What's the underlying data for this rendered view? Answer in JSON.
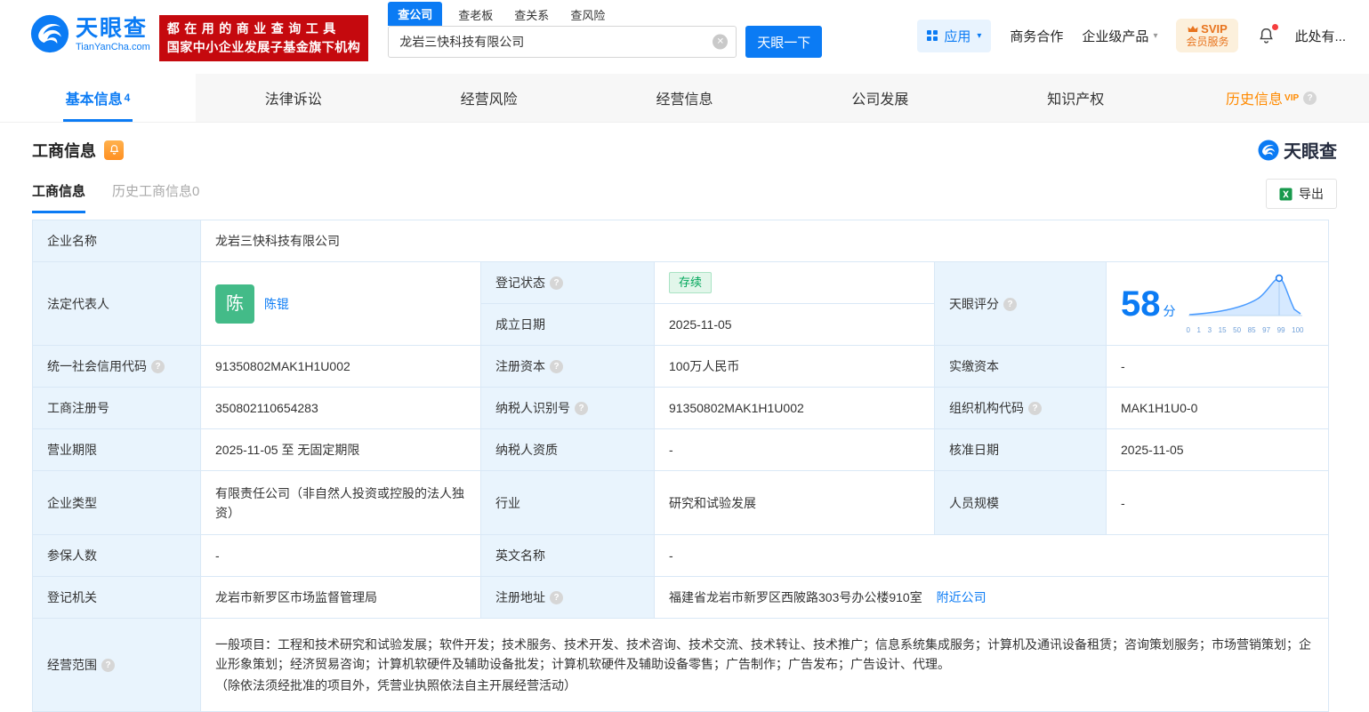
{
  "icons": {
    "help": "?",
    "caret": "▾",
    "close": "✕",
    "vip": "VIP"
  },
  "header": {
    "logo_cn": "天眼查",
    "logo_en": "TianYanCha.com",
    "slogan_line1": "都在用的商业查询工具",
    "slogan_line2": "国家中小企业发展子基金旗下机构",
    "search_tabs": [
      {
        "label": "查公司",
        "active": true
      },
      {
        "label": "查老板",
        "active": false
      },
      {
        "label": "查关系",
        "active": false
      },
      {
        "label": "查风险",
        "active": false
      }
    ],
    "search_value": "龙岩三快科技有限公司",
    "search_button": "天眼一下",
    "apps_label": "应用",
    "cooperation_label": "商务合作",
    "enterprise_label": "企业级产品",
    "svip_line1": "SVIP",
    "svip_line2": "会员服务",
    "more_label": "此处有..."
  },
  "nav_tabs": [
    {
      "label": "基本信息",
      "count": "4",
      "active": true
    },
    {
      "label": "法律诉讼",
      "active": false
    },
    {
      "label": "经营风险",
      "active": false
    },
    {
      "label": "经营信息",
      "active": false
    },
    {
      "label": "公司发展",
      "active": false
    },
    {
      "label": "知识产权",
      "active": false
    },
    {
      "label": "历史信息",
      "vip": true,
      "active": false
    }
  ],
  "section": {
    "title": "工商信息",
    "watermark": "天眼查",
    "subtab_active": "工商信息",
    "subtab_history": "历史工商信息0",
    "export_label": "导出"
  },
  "score": {
    "value": "58",
    "unit": "分",
    "axis": [
      "0",
      "1",
      "3",
      "15",
      "50",
      "85",
      "97",
      "99",
      "100"
    ]
  },
  "info": {
    "company_name_label": "企业名称",
    "company_name": "龙岩三快科技有限公司",
    "legal_rep_label": "法定代表人",
    "legal_rep_avatar": "陈",
    "legal_rep_name": "陈锟",
    "reg_status_label": "登记状态",
    "reg_status": "存续",
    "establish_date_label": "成立日期",
    "establish_date": "2025-11-05",
    "score_label": "天眼评分",
    "credit_code_label": "统一社会信用代码",
    "credit_code": "91350802MAK1H1U002",
    "reg_capital_label": "注册资本",
    "reg_capital": "100万人民币",
    "paid_capital_label": "实缴资本",
    "paid_capital": "-",
    "reg_no_label": "工商注册号",
    "reg_no": "350802110654283",
    "taxpayer_id_label": "纳税人识别号",
    "taxpayer_id": "91350802MAK1H1U002",
    "org_code_label": "组织机构代码",
    "org_code": "MAK1H1U0-0",
    "term_label": "营业期限",
    "term": "2025-11-05 至 无固定期限",
    "taxpayer_quality_label": "纳税人资质",
    "taxpayer_quality": "-",
    "approve_date_label": "核准日期",
    "approve_date": "2025-11-05",
    "company_type_label": "企业类型",
    "company_type": "有限责任公司（非自然人投资或控股的法人独资）",
    "industry_label": "行业",
    "industry": "研究和试验发展",
    "staff_label": "人员规模",
    "staff": "-",
    "insured_label": "参保人数",
    "insured": "-",
    "en_name_label": "英文名称",
    "en_name": "-",
    "registry_label": "登记机关",
    "registry": "龙岩市新罗区市场监督管理局",
    "address_label": "注册地址",
    "address": "福建省龙岩市新罗区西陂路303号办公楼910室",
    "nearby_link": "附近公司",
    "scope_label": "经营范围",
    "scope": "一般项目：工程和技术研究和试验发展；软件开发；技术服务、技术开发、技术咨询、技术交流、技术转让、技术推广；信息系统集成服务；计算机及通讯设备租赁；咨询策划服务；市场营销策划；企业形象策划；经济贸易咨询；计算机软硬件及辅助设备批发；计算机软硬件及辅助设备零售；广告制作；广告发布；广告设计、代理。",
    "scope_note": "（除依法须经批准的项目外，凭营业执照依法自主开展经营活动）"
  }
}
